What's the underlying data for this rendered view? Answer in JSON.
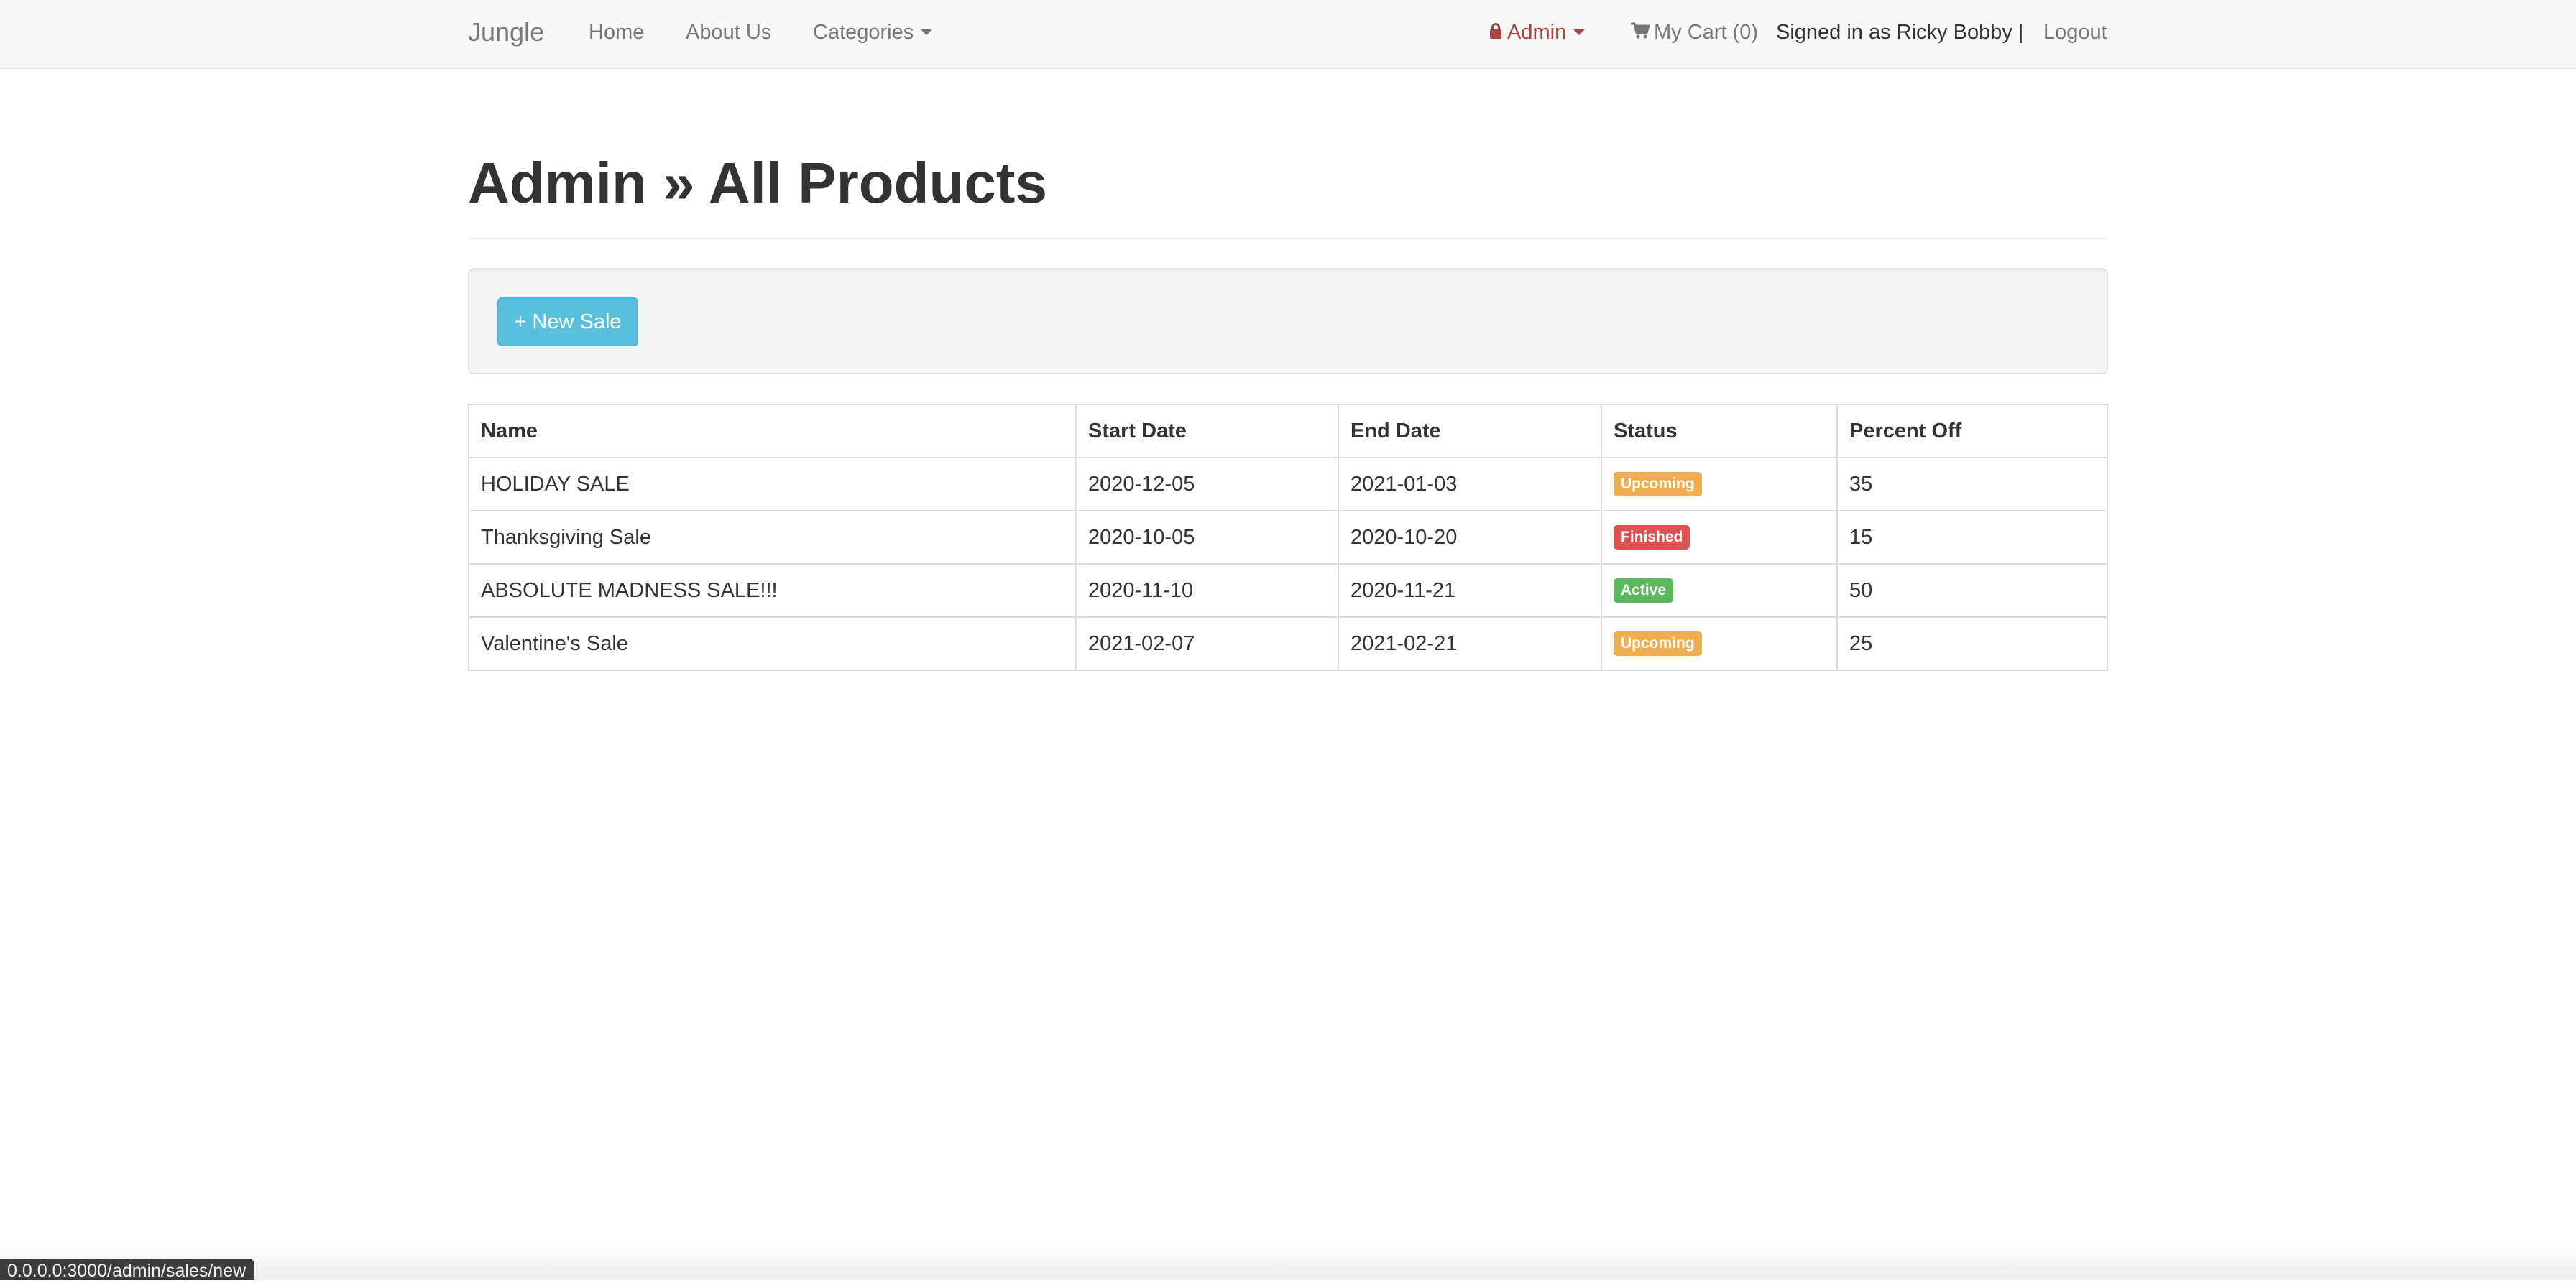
{
  "navbar": {
    "brand": "Jungle",
    "links": {
      "home": "Home",
      "about": "About Us",
      "categories": "Categories"
    },
    "admin_label": "Admin",
    "cart_label": "My Cart (0)",
    "signed_in": "Signed in as Ricky Bobby |",
    "logout": "Logout"
  },
  "page": {
    "title": "Admin » All Products"
  },
  "actions": {
    "new_sale_label": "+ New Sale"
  },
  "sales_table": {
    "headers": {
      "name": "Name",
      "start_date": "Start Date",
      "end_date": "End Date",
      "status": "Status",
      "percent_off": "Percent Off"
    },
    "rows": [
      {
        "name": "HOLIDAY SALE",
        "start_date": "2020-12-05",
        "end_date": "2021-01-03",
        "status": "Upcoming",
        "percent_off": "35"
      },
      {
        "name": "Thanksgiving Sale",
        "start_date": "2020-10-05",
        "end_date": "2020-10-20",
        "status": "Finished",
        "percent_off": "15"
      },
      {
        "name": "ABSOLUTE MADNESS SALE!!!",
        "start_date": "2020-11-10",
        "end_date": "2020-11-21",
        "status": "Active",
        "percent_off": "50"
      },
      {
        "name": "Valentine's Sale",
        "start_date": "2021-02-07",
        "end_date": "2021-02-21",
        "status": "Upcoming",
        "percent_off": "25"
      }
    ]
  },
  "status_colors": {
    "Upcoming": "#f0ad4e",
    "Finished": "#d9534f",
    "Active": "#5cb85c"
  },
  "icons": {
    "admin": "lock-icon",
    "cart": "shopping-cart-icon",
    "dropdown": "caret-down-icon"
  },
  "status_bar": {
    "url": "0.0.0.0:3000/admin/sales/new"
  }
}
